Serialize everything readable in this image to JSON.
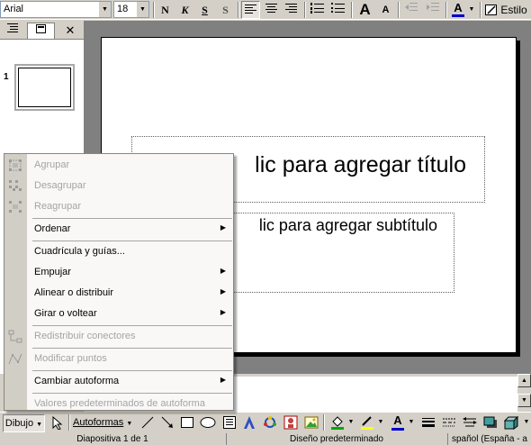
{
  "formatting_toolbar": {
    "font_name": "Arial",
    "font_size": "18",
    "bold_label": "N",
    "italic_label": "K",
    "underline_label": "S",
    "shadow_label": "S",
    "grow_font_label": "A",
    "shrink_font_label": "A",
    "design_label": "Estilo"
  },
  "outline_pane": {
    "close_label": "✕",
    "slide_number": "1"
  },
  "slide": {
    "title_placeholder": "lic para agregar título",
    "subtitle_placeholder": "lic para agregar subtítulo"
  },
  "context_menu": {
    "items": [
      {
        "label": "Agrupar",
        "enabled": false,
        "submenu": false,
        "icon": "group-icon"
      },
      {
        "label": "Desagrupar",
        "enabled": false,
        "submenu": false,
        "icon": "ungroup-icon"
      },
      {
        "label": "Reagrupar",
        "enabled": false,
        "submenu": false,
        "icon": "regroup-icon"
      },
      {
        "label": "Ordenar",
        "enabled": true,
        "submenu": true
      },
      {
        "label": "Cuadrícula y guías...",
        "enabled": true,
        "submenu": false
      },
      {
        "label": "Empujar",
        "enabled": true,
        "submenu": true
      },
      {
        "label": "Alinear o distribuir",
        "enabled": true,
        "submenu": true
      },
      {
        "label": "Girar o voltear",
        "enabled": true,
        "submenu": true
      },
      {
        "label": "Redistribuir conectores",
        "enabled": false,
        "submenu": false,
        "icon": "reroute-connectors-icon"
      },
      {
        "label": "Modificar puntos",
        "enabled": false,
        "submenu": false,
        "icon": "edit-points-icon"
      },
      {
        "label": "Cambiar autoforma",
        "enabled": true,
        "submenu": true
      },
      {
        "label": "Valores predeterminados de autoforma",
        "enabled": false,
        "submenu": false
      }
    ]
  },
  "drawing_toolbar": {
    "draw_menu_label": "Dibujo",
    "autoshapes_label": "Autoformas"
  },
  "status_bar": {
    "slide_info": "Diapositiva 1 de 1",
    "design": "Diseño predeterminado",
    "language": "spañol (España - a"
  },
  "colors": {
    "font_color": "#0000cc",
    "highlight_color": "#ffff00",
    "fill_color": "#00aa00"
  }
}
